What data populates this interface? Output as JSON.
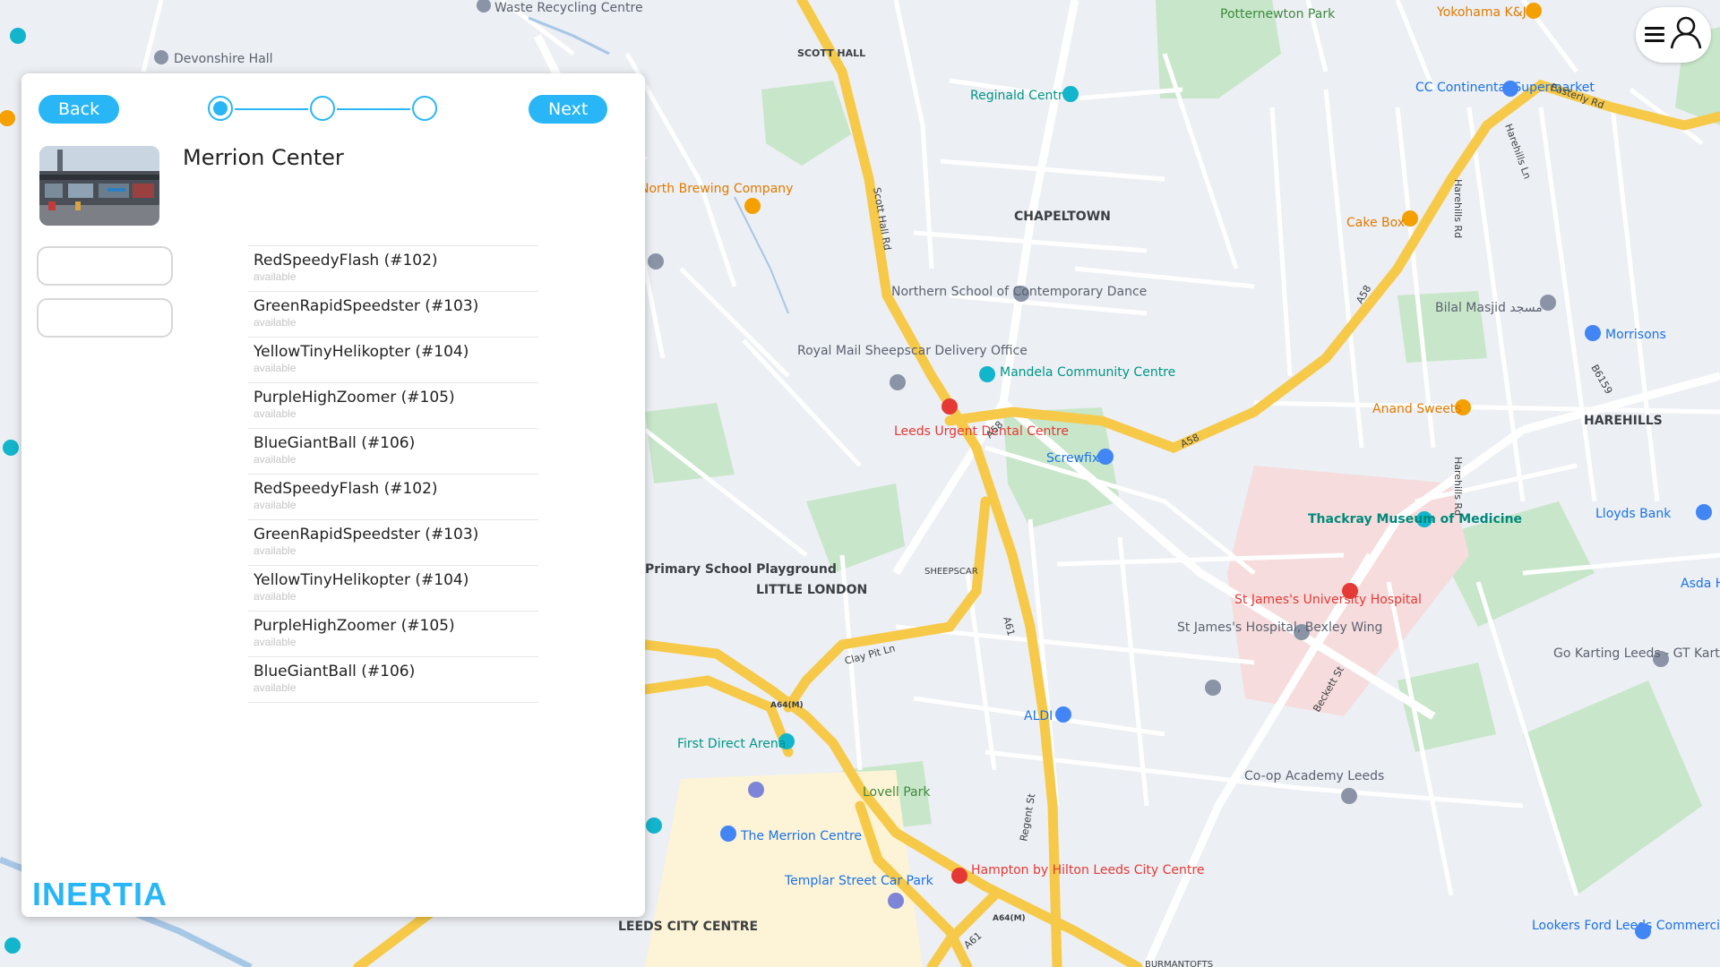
{
  "navigation": {
    "back_label": "Back",
    "next_label": "Next",
    "steps": 3,
    "current_step": 1
  },
  "location": {
    "name": "Merrion Center"
  },
  "vehicles": [
    {
      "name": "RedSpeedyFlash (#102)",
      "status": "available"
    },
    {
      "name": "GreenRapidSpeedster (#103)",
      "status": "available"
    },
    {
      "name": "YellowTinyHelikopter (#104)",
      "status": "available"
    },
    {
      "name": "PurpleHighZoomer (#105)",
      "status": "available"
    },
    {
      "name": "BlueGiantBall (#106)",
      "status": "available"
    },
    {
      "name": "RedSpeedyFlash (#102)",
      "status": "available"
    },
    {
      "name": "GreenRapidSpeedster (#103)",
      "status": "available"
    },
    {
      "name": "YellowTinyHelikopter (#104)",
      "status": "available"
    },
    {
      "name": "PurpleHighZoomer (#105)",
      "status": "available"
    },
    {
      "name": "BlueGiantBall (#106)",
      "status": "available"
    }
  ],
  "brand": "INERTIA",
  "map": {
    "labels": {
      "waste": "Waste Recycling Centre",
      "devonshire": "Devonshire Hall",
      "scott_hall": "SCOTT HALL",
      "potternewton": "Potternewton Park",
      "yokohama": "Yokohama K&J",
      "cc_continental": "CC Continental Supermarket",
      "reginald": "Reginald Centre",
      "chapeltown": "CHAPELTOWN",
      "north_brewing": "North Brewing Company",
      "cake_box": "Cake Box",
      "northern_school": "Northern School of Contemporary Dance",
      "bilal": "Bilal Masjid مسجد",
      "morrisons": "Morrisons",
      "royal_mail": "Royal Mail Sheepscar Delivery Office",
      "mandela": "Mandela Community Centre",
      "leeds_urgent": "Leeds Urgent Dental Centre",
      "anand": "Anand Sweets",
      "harehills": "HAREHILLS",
      "screwfix": "Screwfix",
      "thackray": "Thackray Museum of Medicine",
      "lloyds": "Lloyds Bank",
      "sheepscar": "SHEEPSCAR",
      "little_london": "LITTLE LONDON",
      "st_james": "St James's University Hospital",
      "asda": "Asda Ha Super",
      "st_james_bexley": "St James's Hospital, Bexley Wing",
      "go_karting": "Go Karting Leeds - GT Karting",
      "first_direct": "First Direct Arena",
      "aldi": "ALDI",
      "lovell": "Lovell Park",
      "coop": "Co-op Academy Leeds",
      "merrion_centre": "The Merrion Centre",
      "hampton": "Hampton by Hilton Leeds City Centre",
      "templar": "Templar Street Car Park",
      "leeds_city_centre": "LEEDS CITY CENTRE",
      "burmantofts": "BURMANTOFTS",
      "lookers": "Lookers Ford Leeds Commercial",
      "primary_school": "Primary School Playground"
    },
    "roads": [
      "Scott Hall Rd",
      "A58",
      "A61",
      "A64(M)",
      "Clay Pit Ln",
      "Easterly Rd",
      "Harehills Ln",
      "Harehills Rd",
      "Regent St",
      "Beckett St",
      "B6159"
    ]
  },
  "colors": {
    "accent": "#29b6f6",
    "motorway": "#f7c948",
    "park": "#c8e6c9",
    "hospital": "#f6dcdc"
  }
}
